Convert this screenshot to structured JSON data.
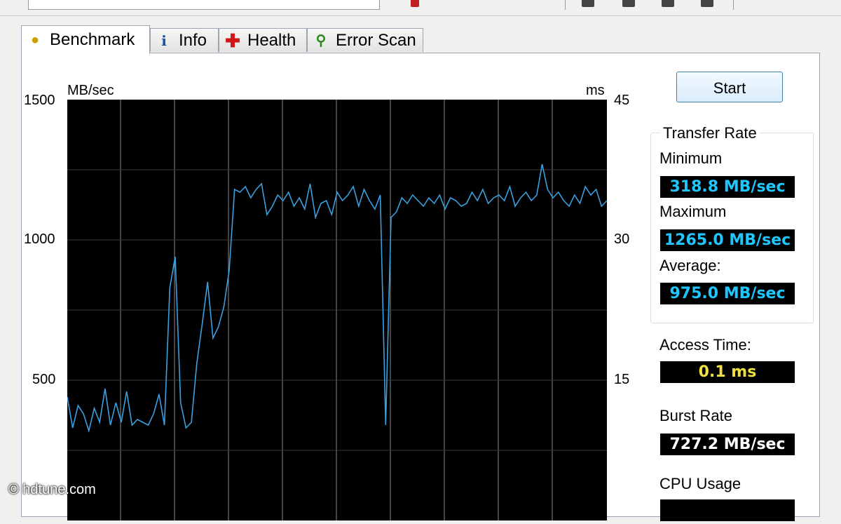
{
  "tabs": [
    {
      "label": "Benchmark",
      "icon": "lightbulb-icon",
      "active": true
    },
    {
      "label": "Info",
      "icon": "info-icon",
      "active": false
    },
    {
      "label": "Health",
      "icon": "health-cross-icon",
      "active": false
    },
    {
      "label": "Error Scan",
      "icon": "magnifier-icon",
      "active": false
    }
  ],
  "chart": {
    "left_unit": "MB/sec",
    "right_unit": "ms",
    "left_ticks": [
      "1500",
      "1000",
      "500"
    ],
    "right_ticks": [
      "45",
      "30",
      "15"
    ]
  },
  "chart_data": {
    "type": "line",
    "ylabel": "MB/sec",
    "y2label": "ms",
    "ylim": [
      0,
      1500
    ],
    "y2lim": [
      0,
      45
    ],
    "grid": true,
    "series": [
      {
        "color": "#3aa0e0",
        "x": [
          0,
          1,
          2,
          3,
          4,
          5,
          6,
          7,
          8,
          9,
          10,
          11,
          12,
          13,
          14,
          15,
          16,
          17,
          18,
          19,
          20,
          21,
          22,
          23,
          24,
          25,
          26,
          27,
          28,
          29,
          30,
          31,
          32,
          33,
          34,
          35,
          36,
          37,
          38,
          39,
          40,
          41,
          42,
          43,
          44,
          45,
          46,
          47,
          48,
          49,
          50,
          51,
          52,
          53,
          54,
          55,
          56,
          57,
          58,
          59,
          60,
          61,
          62,
          63,
          64,
          65,
          66,
          67,
          68,
          69,
          70,
          71,
          72,
          73,
          74,
          75,
          76,
          77,
          78,
          79,
          80,
          81,
          82,
          83,
          84,
          85,
          86,
          87,
          88,
          89,
          90,
          91,
          92,
          93,
          94,
          95,
          96,
          97,
          98,
          99,
          100
        ],
        "values": [
          440,
          330,
          410,
          380,
          320,
          400,
          350,
          470,
          340,
          420,
          350,
          460,
          340,
          360,
          350,
          340,
          380,
          450,
          340,
          830,
          940,
          420,
          330,
          350,
          560,
          700,
          850,
          650,
          690,
          760,
          890,
          1180,
          1170,
          1190,
          1150,
          1180,
          1200,
          1090,
          1120,
          1160,
          1140,
          1170,
          1120,
          1150,
          1110,
          1200,
          1080,
          1130,
          1140,
          1090,
          1170,
          1140,
          1160,
          1190,
          1120,
          1180,
          1140,
          1110,
          1160,
          340,
          1080,
          1100,
          1150,
          1130,
          1160,
          1140,
          1120,
          1150,
          1130,
          1160,
          1110,
          1150,
          1140,
          1120,
          1130,
          1170,
          1140,
          1180,
          1130,
          1150,
          1160,
          1140,
          1190,
          1120,
          1150,
          1170,
          1140,
          1160,
          1270,
          1180,
          1150,
          1170,
          1140,
          1120,
          1160,
          1130,
          1190,
          1160,
          1180,
          1120,
          1140
        ]
      }
    ]
  },
  "start_label": "Start",
  "transfer_rate": {
    "title": "Transfer Rate",
    "minimum_label": "Minimum",
    "minimum_value": "318.8 MB/sec",
    "maximum_label": "Maximum",
    "maximum_value": "1265.0 MB/sec",
    "average_label": "Average:",
    "average_value": "975.0 MB/sec"
  },
  "access_time": {
    "label": "Access Time:",
    "value": "0.1 ms"
  },
  "burst_rate": {
    "label": "Burst Rate",
    "value": "727.2 MB/sec"
  },
  "cpu_usage": {
    "label": "CPU Usage"
  },
  "watermark": "© hdtune.com"
}
